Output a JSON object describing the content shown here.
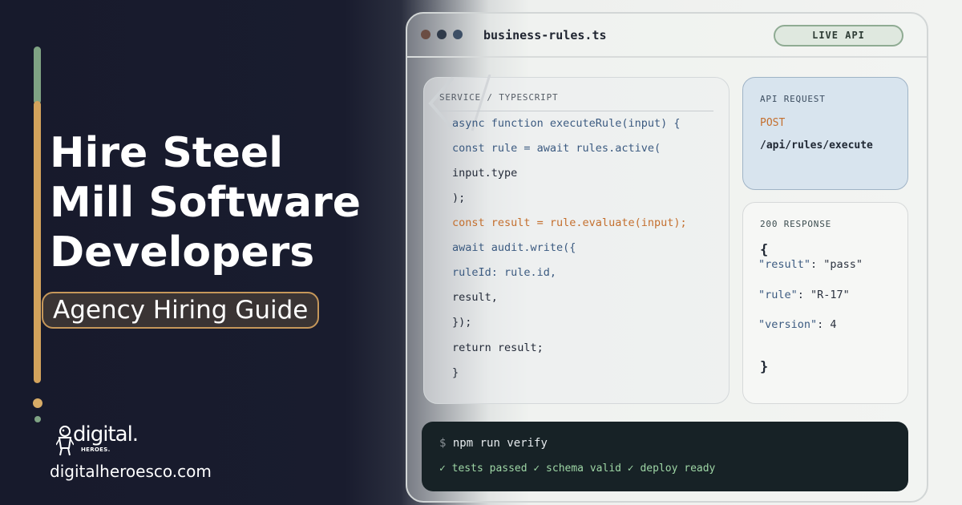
{
  "headline": {
    "lines": [
      "Hire Steel",
      "Mill Software",
      "Developers"
    ],
    "tag": "Agency Hiring Guide"
  },
  "brand": {
    "logo_word": "digital.",
    "logo_sub": "HEROES.",
    "url": "digitalheroesco.com"
  },
  "editor": {
    "filename": "business-rules.ts",
    "status_pill": "LIVE API",
    "window_dot_colors": [
      "#6b4d43",
      "#2f3a4a",
      "#3d4f66"
    ],
    "code_panel": {
      "label": "SERVICE / TYPESCRIPT",
      "lines": [
        "async function executeRule(input) {",
        "const rule = await rules.active(",
        "input.type",
        ");",
        "const result = rule.evaluate(input);",
        "await audit.write({",
        "ruleId: rule.id,",
        "result,",
        "});",
        "return result;",
        "}"
      ]
    },
    "request_card": {
      "label": "API REQUEST",
      "method": "POST",
      "path": "/api/rules/execute"
    },
    "response_card": {
      "label": "200 RESPONSE",
      "open_brace": "{",
      "fields": [
        {
          "key": "\"result\"",
          "sep": ": ",
          "value": "\"pass\""
        },
        {
          "key": "\"rule\"",
          "sep": ": ",
          "value": "\"R-17\""
        },
        {
          "key": "\"version\"",
          "sep": ": ",
          "value": "4"
        }
      ],
      "close_brace": "}"
    },
    "terminal": {
      "prompt": "$",
      "command": "npm run verify",
      "output": "✓ tests passed ✓ schema valid ✓ deploy ready"
    }
  },
  "colors": {
    "accent_gold": "#d3a35c",
    "accent_green": "#7fa384",
    "keyword_orange": "#c46f2e",
    "code_blue": "#3b5a80",
    "terminal_bg": "#172226",
    "terminal_success": "#9ed6a5"
  },
  "icons": [
    "chevron-left-icon",
    "hero-mascot-icon"
  ]
}
